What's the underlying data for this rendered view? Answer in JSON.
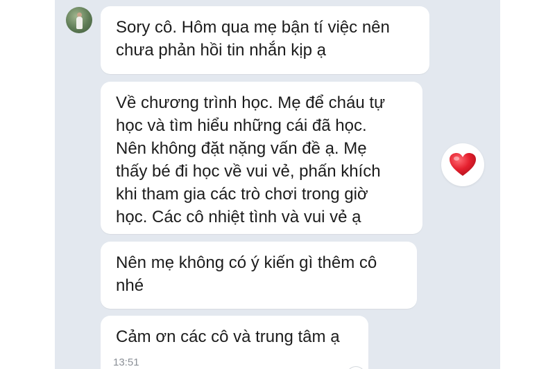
{
  "messages": [
    {
      "text": "Sory cô. Hôm qua mẹ bận tí việc nên\nchưa phản hồi tin nhắn kịp ạ"
    },
    {
      "text": "Về chương trình học. Mẹ để cháu tự\nhọc và tìm hiểu những cái đã học.\nNên không đặt nặng vấn đề ạ. Mẹ\nthấy bé đi học về vui vẻ, phấn khích\nkhi tham gia các trò chơi trong giờ\nhọc. Các cô nhiệt tình và vui vẻ ạ"
    },
    {
      "text": "Nên mẹ không có ý kiến gì thêm cô\nnhé"
    },
    {
      "text": "Cảm ơn các cô và trung tâm ạ",
      "time": "13:51"
    }
  ],
  "reaction": {
    "icon": "heart-icon",
    "color": "#e5202e"
  },
  "colors": {
    "chat_background": "#e3e8ef",
    "bubble": "#ffffff"
  }
}
